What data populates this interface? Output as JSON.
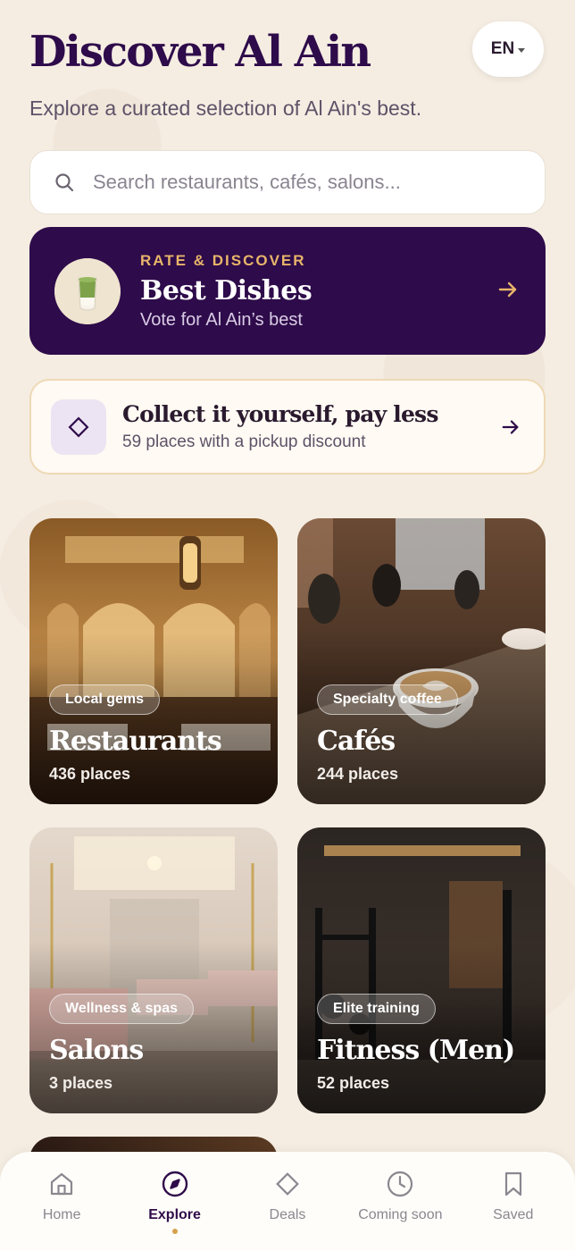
{
  "header": {
    "title": "Discover Al Ain",
    "subtitle": "Explore a curated selection of Al Ain's best.",
    "language": "EN"
  },
  "search": {
    "placeholder": "Search restaurants, cafés, salons...",
    "value": ""
  },
  "promo": {
    "eyebrow": "RATE & DISCOVER",
    "title": "Best Dishes",
    "subtitle": "Vote for Al Ain’s best"
  },
  "pickup": {
    "title": "Collect it yourself, pay less",
    "subtitle": "59 places with a pickup discount"
  },
  "categories": [
    {
      "badge": "Local gems",
      "title": "Restaurants",
      "count": "436 places"
    },
    {
      "badge": "Specialty coffee",
      "title": "Cafés",
      "count": "244 places"
    },
    {
      "badge": "Wellness & spas",
      "title": "Salons",
      "count": "3 places"
    },
    {
      "badge": "Elite training",
      "title": "Fitness (Men)",
      "count": "52 places"
    }
  ],
  "tabs": [
    {
      "label": "Home",
      "icon": "home-icon"
    },
    {
      "label": "Explore",
      "icon": "compass-icon",
      "active": true
    },
    {
      "label": "Deals",
      "icon": "tag-diamond-icon"
    },
    {
      "label": "Coming soon",
      "icon": "clock-icon"
    },
    {
      "label": "Saved",
      "icon": "bookmark-icon"
    }
  ],
  "colors": {
    "brand": "#2e0b4a",
    "accent": "#e8b56a",
    "background": "#f5ede2"
  }
}
